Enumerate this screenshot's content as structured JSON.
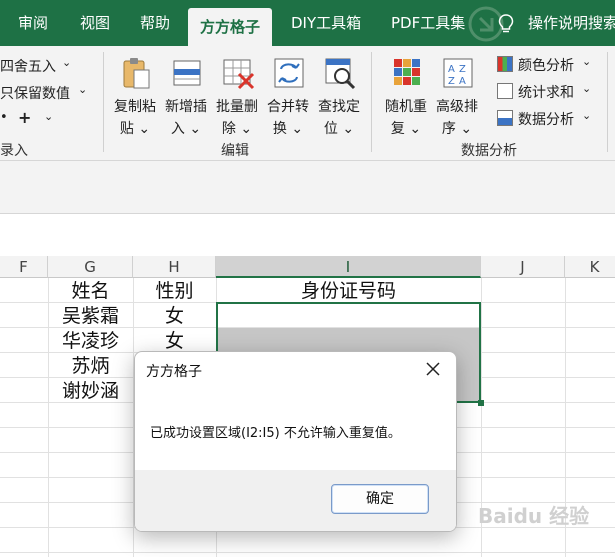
{
  "ribbon_tabs": {
    "review": "审阅",
    "view": "视图",
    "help": "帮助",
    "fangfang": "方方格子",
    "diy": "DIY工具箱",
    "pdf": "PDF工具集",
    "tell_me": "操作说明搜索"
  },
  "ribbon": {
    "round_label": "四舍五入",
    "keep_value_label": "只保留数值",
    "plus_label": "+",
    "record_group_label": "录入",
    "copy_paste": [
      "复制粘",
      "贴"
    ],
    "insert_new": [
      "新增插",
      "入"
    ],
    "batch_delete": [
      "批量删",
      "除"
    ],
    "merge_convert": [
      "合并转",
      "换"
    ],
    "find_locate": [
      "查找定",
      "位"
    ],
    "edit_group_label": "编辑",
    "random_repeat": [
      "随机重",
      "复"
    ],
    "advanced_sort": [
      "高级排",
      "序"
    ],
    "color_analysis": "颜色分析",
    "stat_sum": "统计求和",
    "data_analysis": "数据分析",
    "data_analysis_group_label": "数据分析"
  },
  "columns": [
    "F",
    "G",
    "H",
    "I",
    "J",
    "K"
  ],
  "sheet": {
    "header_name": "姓名",
    "header_gender": "性别",
    "header_id": "身份证号码",
    "rows": [
      {
        "name": "吴紫霜",
        "gender": "女"
      },
      {
        "name": "华凌珍",
        "gender": "女"
      },
      {
        "name": "苏炳",
        "gender": ""
      },
      {
        "name": "谢妙涵",
        "gender": ""
      }
    ]
  },
  "dialog": {
    "title": "方方格子",
    "message": "已成功设置区域(I2:I5) 不允许输入重复值。",
    "ok": "确定"
  },
  "watermark": "Baidu 经验",
  "colors": {
    "accent": "#1e7145",
    "selection": "#217346"
  }
}
